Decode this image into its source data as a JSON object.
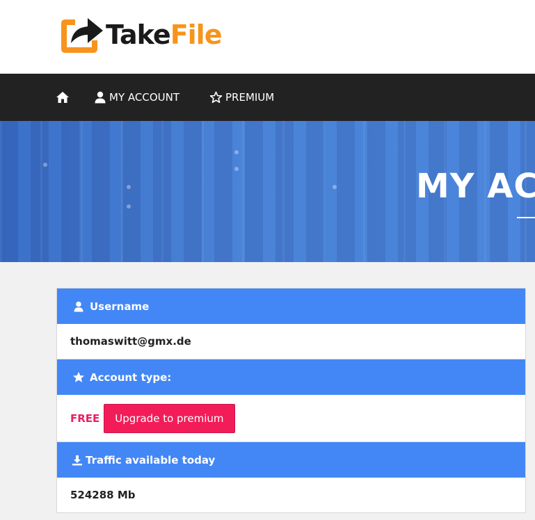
{
  "brand": {
    "name_part1": "Take",
    "name_part2": "File",
    "accent_color": "#f7941d"
  },
  "nav": {
    "home_icon": "home-icon",
    "items": [
      {
        "label": "MY ACCOUNT",
        "icon": "user-icon"
      },
      {
        "label": "PREMIUM",
        "icon": "star-outline-icon"
      }
    ]
  },
  "hero": {
    "title": "MY ACCOUNT"
  },
  "account": {
    "username_header": "Username",
    "username_value": "thomaswitt@gmx.de",
    "type_header": "Account type:",
    "type_value": "FREE",
    "upgrade_label": "Upgrade to premium",
    "traffic_header": "Traffic available today",
    "traffic_value": "524288 Mb"
  },
  "colors": {
    "nav_bg": "#222222",
    "header_blue": "#4287f5",
    "free_color": "#e91e63",
    "upgrade_button": "#f21c59"
  }
}
